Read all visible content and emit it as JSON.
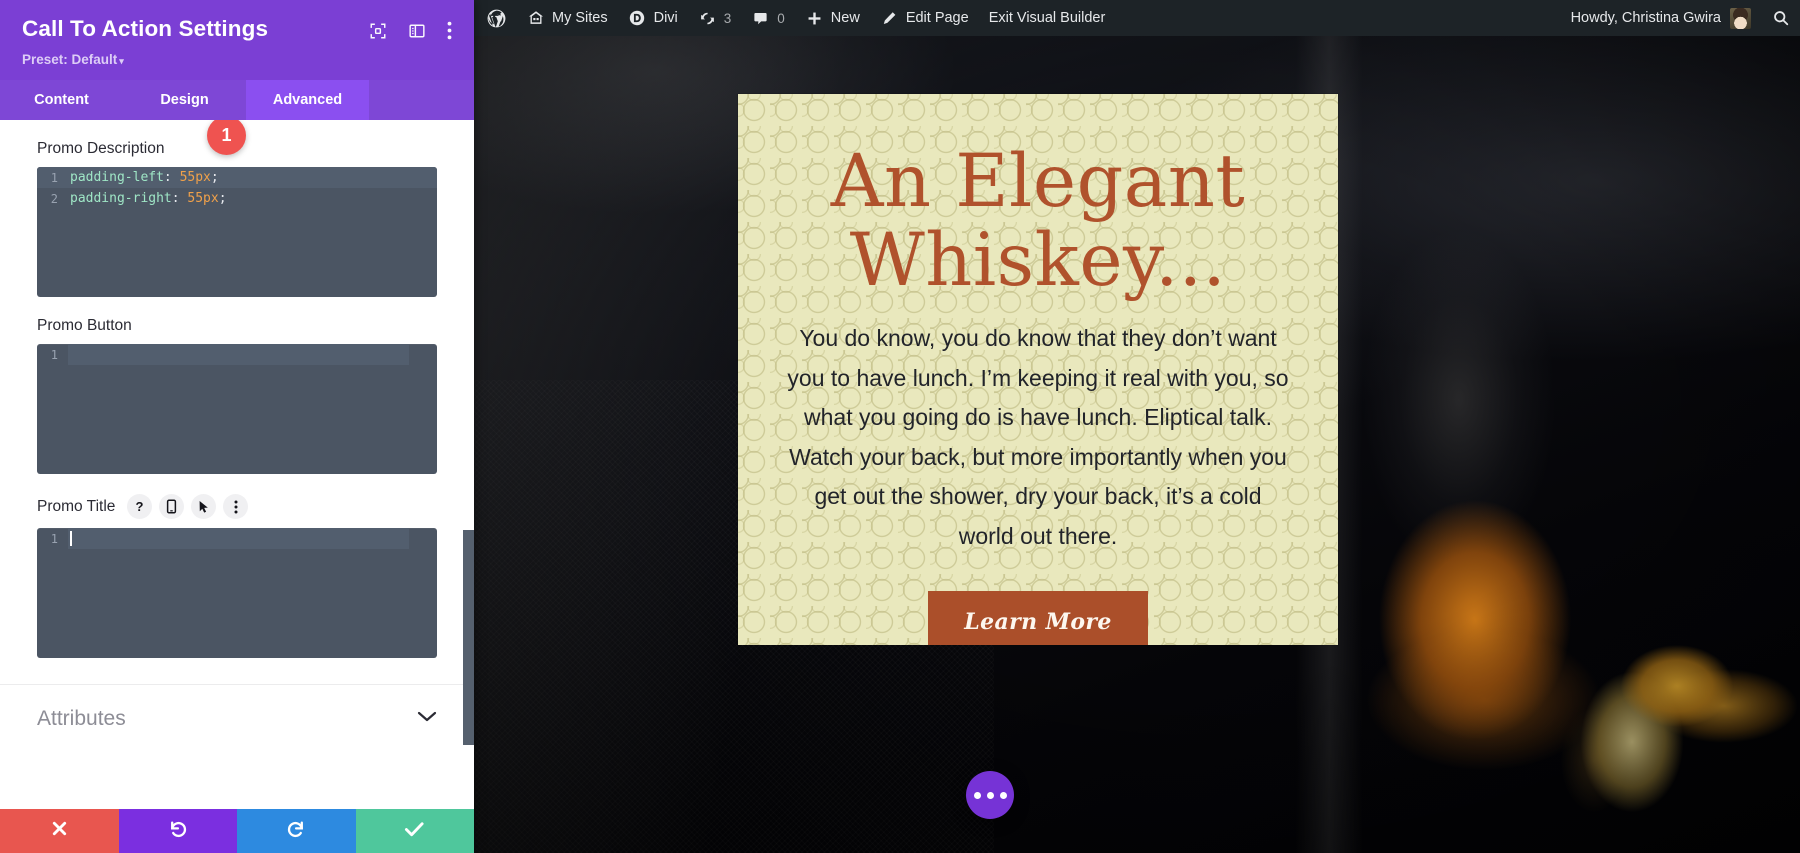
{
  "wp_admin_bar": {
    "items": [
      {
        "icon": "wordpress-logo-icon",
        "label": ""
      },
      {
        "icon": "my-sites-icon",
        "label": "My Sites"
      },
      {
        "icon": "divi-icon",
        "label": "Divi"
      },
      {
        "icon": "updates-icon",
        "label": "3"
      },
      {
        "icon": "comments-icon",
        "label": "0"
      },
      {
        "icon": "plus-icon",
        "label": "New"
      },
      {
        "icon": "pencil-icon",
        "label": "Edit Page"
      },
      {
        "icon": "",
        "label": "Exit Visual Builder"
      }
    ],
    "howdy": "Howdy, Christina Gwira",
    "search_icon": "search-icon"
  },
  "panel": {
    "title": "Call To Action Settings",
    "preset_label": "Preset: Default",
    "preset_caret": "▾",
    "head_icons": [
      {
        "name": "expand-icon"
      },
      {
        "name": "layout-panel-icon"
      },
      {
        "name": "kebab-menu-icon"
      }
    ],
    "tabs": [
      {
        "label": "Content",
        "active": false
      },
      {
        "label": "Design",
        "active": false
      },
      {
        "label": "Advanced",
        "active": true
      }
    ],
    "fields": [
      {
        "label": "Promo Description",
        "badge": "1",
        "icons": [],
        "code_lines": [
          {
            "num": "1",
            "prop": "padding-left",
            "value": "55px",
            "highlighted": true
          },
          {
            "num": "2",
            "prop": "padding-right",
            "value": "55px",
            "highlighted": false
          }
        ]
      },
      {
        "label": "Promo Button",
        "badge": "",
        "icons": [],
        "code_lines": [
          {
            "num": "1",
            "prop": "",
            "value": "",
            "highlighted": true
          }
        ]
      },
      {
        "label": "Promo Title",
        "badge": "",
        "icons": [
          {
            "name": "help-icon",
            "glyph": "?"
          },
          {
            "name": "responsive-mobile-icon",
            "glyph": ""
          },
          {
            "name": "hover-cursor-icon",
            "glyph": ""
          },
          {
            "name": "kebab-menu-icon",
            "glyph": ""
          }
        ],
        "code_lines": [
          {
            "num": "1",
            "prop": "",
            "value": "",
            "highlighted": true,
            "caret": true
          }
        ]
      }
    ],
    "attributes": {
      "label": "Attributes",
      "chevron_icon": "chevron-down-icon"
    },
    "actions": [
      {
        "name": "cancel-button",
        "icon": "close-x-icon",
        "color": "#e8564f"
      },
      {
        "name": "undo-button",
        "icon": "undo-arrow-icon",
        "color": "#7b2fe0"
      },
      {
        "name": "redo-button",
        "icon": "redo-arrow-icon",
        "color": "#2d8ae0"
      },
      {
        "name": "save-button",
        "icon": "check-icon",
        "color": "#4fc79c"
      }
    ]
  },
  "cta": {
    "title_line1": "An Elegant",
    "title_line2": "Whiskey...",
    "body": "You do know, you do know that they don’t want you to have lunch. I’m keeping it real with you, so what you going do is have lunch. Eliptical talk. Watch your back, but more importantly when you get out the shower, dry your back, it’s a cold world out there.",
    "button_label": "Learn More",
    "colors": {
      "background": "#e9e8bd",
      "title": "#b0522c",
      "button_bg": "#ab4f2a",
      "button_text": "#fdf7ef"
    }
  },
  "visual_builder": {
    "fab_icon": "ellipsis-icon",
    "fab_color": "#7633d6"
  }
}
